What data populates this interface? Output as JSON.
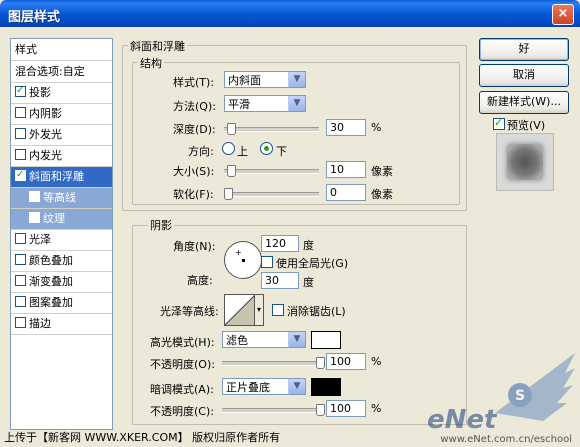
{
  "window": {
    "title": "图层样式",
    "close": "×"
  },
  "styles_list": {
    "header": "样式",
    "blend": "混合选项:自定",
    "items": [
      {
        "label": "投影",
        "checked": true
      },
      {
        "label": "内阴影",
        "checked": false
      },
      {
        "label": "外发光",
        "checked": false
      },
      {
        "label": "内发光",
        "checked": false
      },
      {
        "label": "斜面和浮雕",
        "checked": true,
        "selected": true
      },
      {
        "label": "等高线",
        "checked": false,
        "sub": true
      },
      {
        "label": "纹理",
        "checked": false,
        "sub": true
      },
      {
        "label": "光泽",
        "checked": false
      },
      {
        "label": "颜色叠加",
        "checked": false
      },
      {
        "label": "渐变叠加",
        "checked": false
      },
      {
        "label": "图案叠加",
        "checked": false
      },
      {
        "label": "描边",
        "checked": false
      }
    ]
  },
  "bevel": {
    "group_title": "斜面和浮雕",
    "structure_title": "结构",
    "style_label": "样式(T):",
    "style_value": "内斜面",
    "technique_label": "方法(Q):",
    "technique_value": "平滑",
    "depth_label": "深度(D):",
    "depth_value": "30",
    "depth_unit": "%",
    "depth_level": 0.03,
    "direction_label": "方向:",
    "direction_up": "上",
    "direction_down": "下",
    "size_label": "大小(S):",
    "size_value": "10",
    "size_unit": "像素",
    "size_level": 0.04,
    "soften_label": "软化(F):",
    "soften_value": "0",
    "soften_unit": "像素",
    "soften_level": 0.0
  },
  "shading": {
    "title": "阴影",
    "angle_label": "角度(N):",
    "angle_value": "120",
    "angle_unit": "度",
    "global_light_label": "使用全局光(G)",
    "altitude_label": "高度:",
    "altitude_value": "30",
    "altitude_unit": "度",
    "gloss_label": "光泽等高线:",
    "anti_alias_label": "消除锯齿(L)",
    "highlight_mode_label": "高光模式(H):",
    "highlight_mode_value": "滤色",
    "highlight_color": "#FFFFFF",
    "highlight_opacity_label": "不透明度(O):",
    "highlight_opacity_value": "100",
    "highlight_opacity_unit": "%",
    "shadow_mode_label": "暗调模式(A):",
    "shadow_mode_value": "正片叠底",
    "shadow_color": "#000000",
    "shadow_opacity_label": "不透明度(C):",
    "shadow_opacity_value": "100",
    "shadow_opacity_unit": "%"
  },
  "buttons": {
    "ok": "好",
    "cancel": "取消",
    "new_style": "新建样式(W)...",
    "preview": "预览(V)"
  },
  "footer": {
    "text": "上传于【新客网 WWW.XKER.COM】 版权归原作者所有",
    "url": "www.eNet.com.cn/eschool"
  },
  "watermark": {
    "brand": "eNet"
  }
}
